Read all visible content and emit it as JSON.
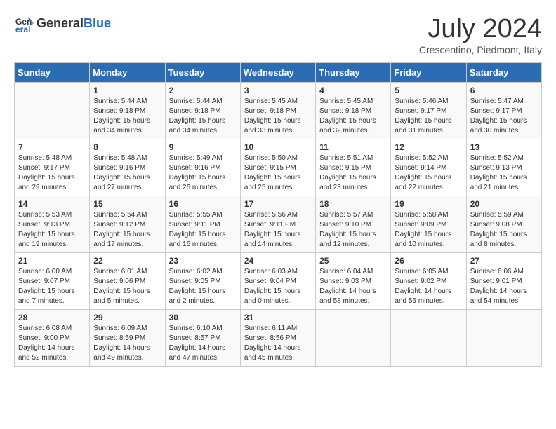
{
  "header": {
    "logo_line1": "General",
    "logo_line2": "Blue",
    "month_year": "July 2024",
    "location": "Crescentino, Piedmont, Italy"
  },
  "days_of_week": [
    "Sunday",
    "Monday",
    "Tuesday",
    "Wednesday",
    "Thursday",
    "Friday",
    "Saturday"
  ],
  "weeks": [
    [
      {
        "day": "",
        "content": ""
      },
      {
        "day": "1",
        "content": "Sunrise: 5:44 AM\nSunset: 9:18 PM\nDaylight: 15 hours\nand 34 minutes."
      },
      {
        "day": "2",
        "content": "Sunrise: 5:44 AM\nSunset: 9:18 PM\nDaylight: 15 hours\nand 34 minutes."
      },
      {
        "day": "3",
        "content": "Sunrise: 5:45 AM\nSunset: 9:18 PM\nDaylight: 15 hours\nand 33 minutes."
      },
      {
        "day": "4",
        "content": "Sunrise: 5:45 AM\nSunset: 9:18 PM\nDaylight: 15 hours\nand 32 minutes."
      },
      {
        "day": "5",
        "content": "Sunrise: 5:46 AM\nSunset: 9:17 PM\nDaylight: 15 hours\nand 31 minutes."
      },
      {
        "day": "6",
        "content": "Sunrise: 5:47 AM\nSunset: 9:17 PM\nDaylight: 15 hours\nand 30 minutes."
      }
    ],
    [
      {
        "day": "7",
        "content": "Sunrise: 5:48 AM\nSunset: 9:17 PM\nDaylight: 15 hours\nand 29 minutes."
      },
      {
        "day": "8",
        "content": "Sunrise: 5:48 AM\nSunset: 9:16 PM\nDaylight: 15 hours\nand 27 minutes."
      },
      {
        "day": "9",
        "content": "Sunrise: 5:49 AM\nSunset: 9:16 PM\nDaylight: 15 hours\nand 26 minutes."
      },
      {
        "day": "10",
        "content": "Sunrise: 5:50 AM\nSunset: 9:15 PM\nDaylight: 15 hours\nand 25 minutes."
      },
      {
        "day": "11",
        "content": "Sunrise: 5:51 AM\nSunset: 9:15 PM\nDaylight: 15 hours\nand 23 minutes."
      },
      {
        "day": "12",
        "content": "Sunrise: 5:52 AM\nSunset: 9:14 PM\nDaylight: 15 hours\nand 22 minutes."
      },
      {
        "day": "13",
        "content": "Sunrise: 5:52 AM\nSunset: 9:13 PM\nDaylight: 15 hours\nand 21 minutes."
      }
    ],
    [
      {
        "day": "14",
        "content": "Sunrise: 5:53 AM\nSunset: 9:13 PM\nDaylight: 15 hours\nand 19 minutes."
      },
      {
        "day": "15",
        "content": "Sunrise: 5:54 AM\nSunset: 9:12 PM\nDaylight: 15 hours\nand 17 minutes."
      },
      {
        "day": "16",
        "content": "Sunrise: 5:55 AM\nSunset: 9:11 PM\nDaylight: 15 hours\nand 16 minutes."
      },
      {
        "day": "17",
        "content": "Sunrise: 5:56 AM\nSunset: 9:11 PM\nDaylight: 15 hours\nand 14 minutes."
      },
      {
        "day": "18",
        "content": "Sunrise: 5:57 AM\nSunset: 9:10 PM\nDaylight: 15 hours\nand 12 minutes."
      },
      {
        "day": "19",
        "content": "Sunrise: 5:58 AM\nSunset: 9:09 PM\nDaylight: 15 hours\nand 10 minutes."
      },
      {
        "day": "20",
        "content": "Sunrise: 5:59 AM\nSunset: 9:08 PM\nDaylight: 15 hours\nand 8 minutes."
      }
    ],
    [
      {
        "day": "21",
        "content": "Sunrise: 6:00 AM\nSunset: 9:07 PM\nDaylight: 15 hours\nand 7 minutes."
      },
      {
        "day": "22",
        "content": "Sunrise: 6:01 AM\nSunset: 9:06 PM\nDaylight: 15 hours\nand 5 minutes."
      },
      {
        "day": "23",
        "content": "Sunrise: 6:02 AM\nSunset: 9:05 PM\nDaylight: 15 hours\nand 2 minutes."
      },
      {
        "day": "24",
        "content": "Sunrise: 6:03 AM\nSunset: 9:04 PM\nDaylight: 15 hours\nand 0 minutes."
      },
      {
        "day": "25",
        "content": "Sunrise: 6:04 AM\nSunset: 9:03 PM\nDaylight: 14 hours\nand 58 minutes."
      },
      {
        "day": "26",
        "content": "Sunrise: 6:05 AM\nSunset: 9:02 PM\nDaylight: 14 hours\nand 56 minutes."
      },
      {
        "day": "27",
        "content": "Sunrise: 6:06 AM\nSunset: 9:01 PM\nDaylight: 14 hours\nand 54 minutes."
      }
    ],
    [
      {
        "day": "28",
        "content": "Sunrise: 6:08 AM\nSunset: 9:00 PM\nDaylight: 14 hours\nand 52 minutes."
      },
      {
        "day": "29",
        "content": "Sunrise: 6:09 AM\nSunset: 8:59 PM\nDaylight: 14 hours\nand 49 minutes."
      },
      {
        "day": "30",
        "content": "Sunrise: 6:10 AM\nSunset: 8:57 PM\nDaylight: 14 hours\nand 47 minutes."
      },
      {
        "day": "31",
        "content": "Sunrise: 6:11 AM\nSunset: 8:56 PM\nDaylight: 14 hours\nand 45 minutes."
      },
      {
        "day": "",
        "content": ""
      },
      {
        "day": "",
        "content": ""
      },
      {
        "day": "",
        "content": ""
      }
    ]
  ]
}
